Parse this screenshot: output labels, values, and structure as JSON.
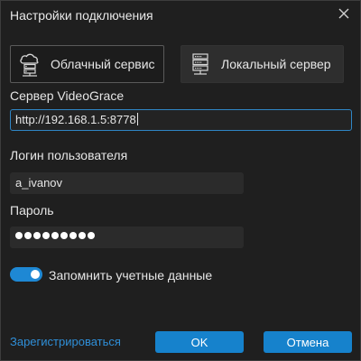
{
  "window": {
    "title": "Настройки подключения"
  },
  "mode": {
    "cloud_label": "Облачный сервис",
    "local_label": "Локальный сервер",
    "selected": "local"
  },
  "server": {
    "label": "Сервер VideoGrace",
    "value": "http://192.168.1.5:8778"
  },
  "login": {
    "label": "Логин пользователя",
    "value": "a_ivanov"
  },
  "password": {
    "label": "Пароль",
    "masked_length": 9
  },
  "remember": {
    "label": "Запомнить учетные данные",
    "checked": true
  },
  "footer": {
    "register_link": "Зарегистрироваться",
    "ok_label": "OK",
    "cancel_label": "Отмена"
  },
  "colors": {
    "accent": "#1682cc",
    "link": "#2f8fd8",
    "focus_border": "#2f86c6"
  },
  "icons": {
    "close": "close-icon",
    "cloud": "cloud-server-icon",
    "local": "server-rack-icon"
  }
}
